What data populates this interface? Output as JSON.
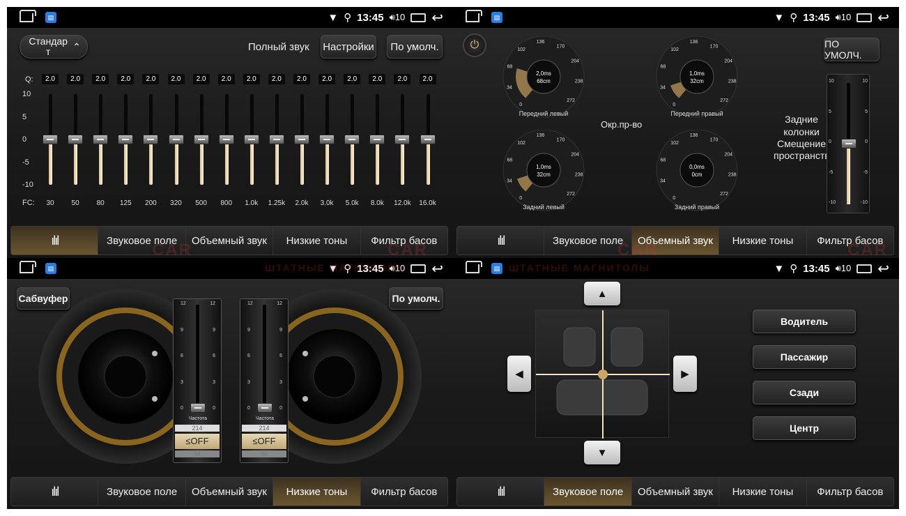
{
  "status_bar": {
    "time": "13:45",
    "volume": "10"
  },
  "eq": {
    "preset": "Стандар т",
    "full_sound": "Полный звук",
    "settings": "Настройки",
    "default": "По умолч.",
    "q_label": "Q:",
    "fc_label": "FC:",
    "db_ticks": [
      "10",
      "5",
      "0",
      "-5",
      "-10"
    ],
    "q_values": [
      "2.0",
      "2.0",
      "2.0",
      "2.0",
      "2.0",
      "2.0",
      "2.0",
      "2.0",
      "2.0",
      "2.0",
      "2.0",
      "2.0",
      "2.0",
      "2.0",
      "2.0",
      "2.0"
    ],
    "freqs": [
      "30",
      "50",
      "80",
      "125",
      "200",
      "320",
      "500",
      "800",
      "1.0k",
      "1.25k",
      "2.0k",
      "3.0k",
      "5.0k",
      "8.0k",
      "12.0k",
      "16.0k"
    ],
    "gains_db": [
      0,
      0,
      0,
      0,
      0,
      0,
      0,
      0,
      0,
      0,
      0,
      0,
      0,
      0,
      0,
      0
    ]
  },
  "surround": {
    "default": "ПО УМОЛЧ.",
    "env_label": "Окр.пр-во",
    "rear_speakers": "Задние колонки",
    "spatial_shift": "Смещение пространства",
    "dial_ticks": [
      "0",
      "34",
      "68",
      "102",
      "136",
      "170",
      "204",
      "238",
      "272"
    ],
    "shift_ticks": [
      "10",
      "5",
      "0",
      "-5",
      "-10"
    ],
    "shift_value": 0,
    "dials": [
      {
        "name": "Передний левый",
        "ms": "2,0ms",
        "cm": "68cm"
      },
      {
        "name": "Передний правый",
        "ms": "1,0ms",
        "cm": "32cm"
      },
      {
        "name": "Задний левый",
        "ms": "1,0ms",
        "cm": "32cm"
      },
      {
        "name": "Задний правый",
        "ms": "0,0ms",
        "cm": "0cm"
      }
    ]
  },
  "bass": {
    "subwoofer": "Сабвуфер",
    "default": "По умолч.",
    "freq_label": "Частота",
    "ticks": [
      "12",
      "9",
      "6",
      "3",
      "0"
    ],
    "level": 0,
    "freq_above": "214",
    "filter_value": "≤OFF",
    "freq_below": "54"
  },
  "field": {
    "up": "▲",
    "down": "▼",
    "left": "◀",
    "right": "▶",
    "buttons": [
      "Водитель",
      "Пассажир",
      "Сзади",
      "Центр"
    ]
  },
  "tabs": [
    "",
    "Звуковое поле",
    "Объемный звук",
    "Низкие тоны",
    "Фильтр басов"
  ],
  "tab_icon": "ılıl",
  "watermark": {
    "car": "CAR",
    "tagline": "ШТАТНЫЕ МАГНИТОЛЫ"
  },
  "colors": {
    "accent": "#c9a56a",
    "active_tab": "#6b5530"
  }
}
